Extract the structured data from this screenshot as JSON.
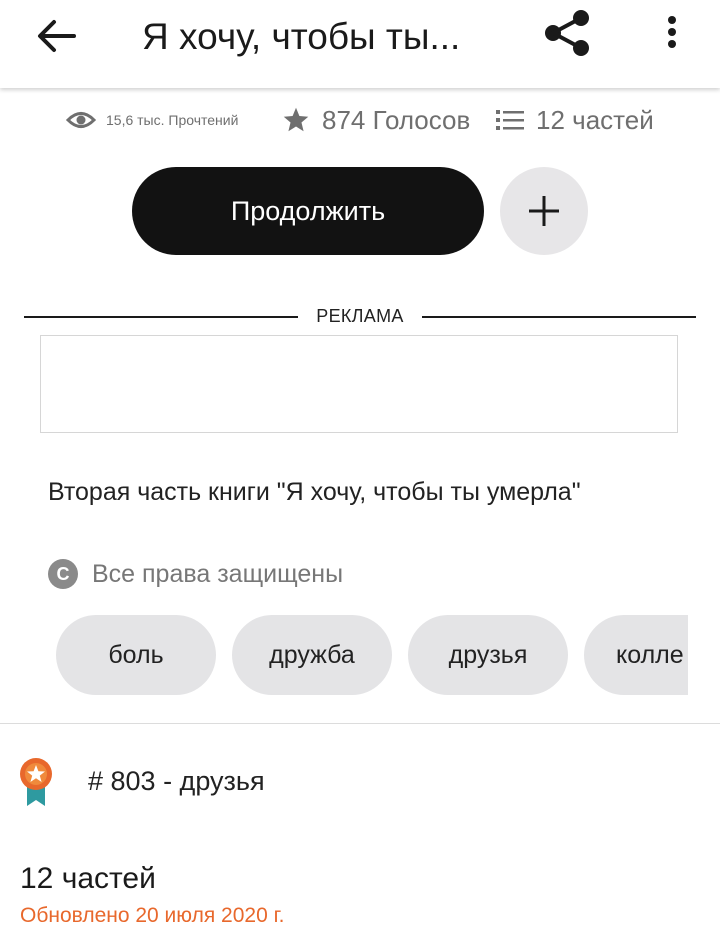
{
  "header": {
    "title": "Я хочу, чтобы ты...",
    "icons": [
      "back-arrow-icon",
      "share-icon",
      "more-vert-icon"
    ]
  },
  "stats": {
    "reads": "15,6 тыс. Прочтений",
    "votes": "874 Голосов",
    "parts": "12 частей"
  },
  "actions": {
    "continue_label": "Продолжить",
    "add_icon": "plus-icon"
  },
  "ad": {
    "label": "РЕКЛАМА"
  },
  "description": "Вторая часть книги \"Я хочу, чтобы ты умерла\"",
  "copyright": {
    "symbol": "C",
    "text": "Все права защищены"
  },
  "tags": [
    "боль",
    "дружба",
    "друзья",
    "колле"
  ],
  "ranking": {
    "text": "# 803 - друзья"
  },
  "table_of_contents": {
    "parts_count": "12 частей",
    "updated": "Обновлено 20 июля 2020 г."
  },
  "colors": {
    "accent_orange": "#e8682c",
    "dark_button": "#121212",
    "chip_bg": "#e4e4e6",
    "medal_ribbon": "#2e9aa0"
  }
}
